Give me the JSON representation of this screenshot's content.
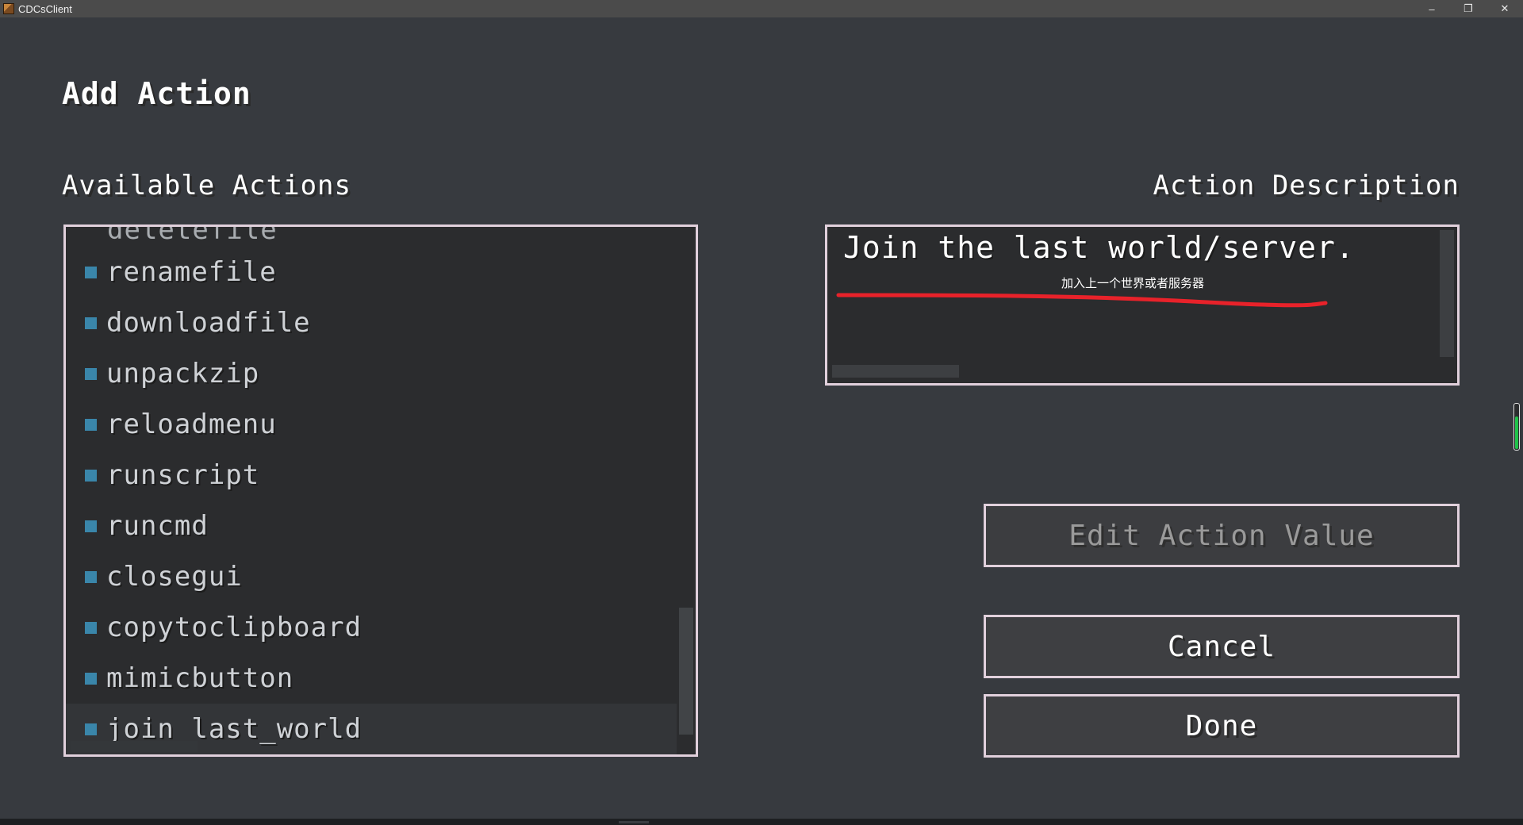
{
  "window": {
    "title": "CDCsClient",
    "minimize": "–",
    "restore": "❐",
    "close": "✕"
  },
  "screen": {
    "title": "Add Action",
    "available_label": "Available Actions",
    "description_label": "Action Description"
  },
  "actions": {
    "partial_top": "deletefile",
    "items": [
      "renamefile",
      "downloadfile",
      "unpackzip",
      "reloadmenu",
      "runscript",
      "runcmd",
      "closegui",
      "copytoclipboard",
      "mimicbutton",
      "join_last_world"
    ],
    "selected": "join_last_world"
  },
  "description": {
    "text": "Join the last world/server.",
    "annotation": "加入上一个世界或者服务器",
    "annotation_color": "#e8222a"
  },
  "buttons": {
    "edit": "Edit Action Value",
    "edit_enabled": false,
    "cancel": "Cancel",
    "done": "Done"
  },
  "colors": {
    "background": "#373a3f",
    "panel": "#2b2c2e",
    "border": "#e1d0dc",
    "bullet": "#3a86aa",
    "indicator": "#20c24a"
  }
}
